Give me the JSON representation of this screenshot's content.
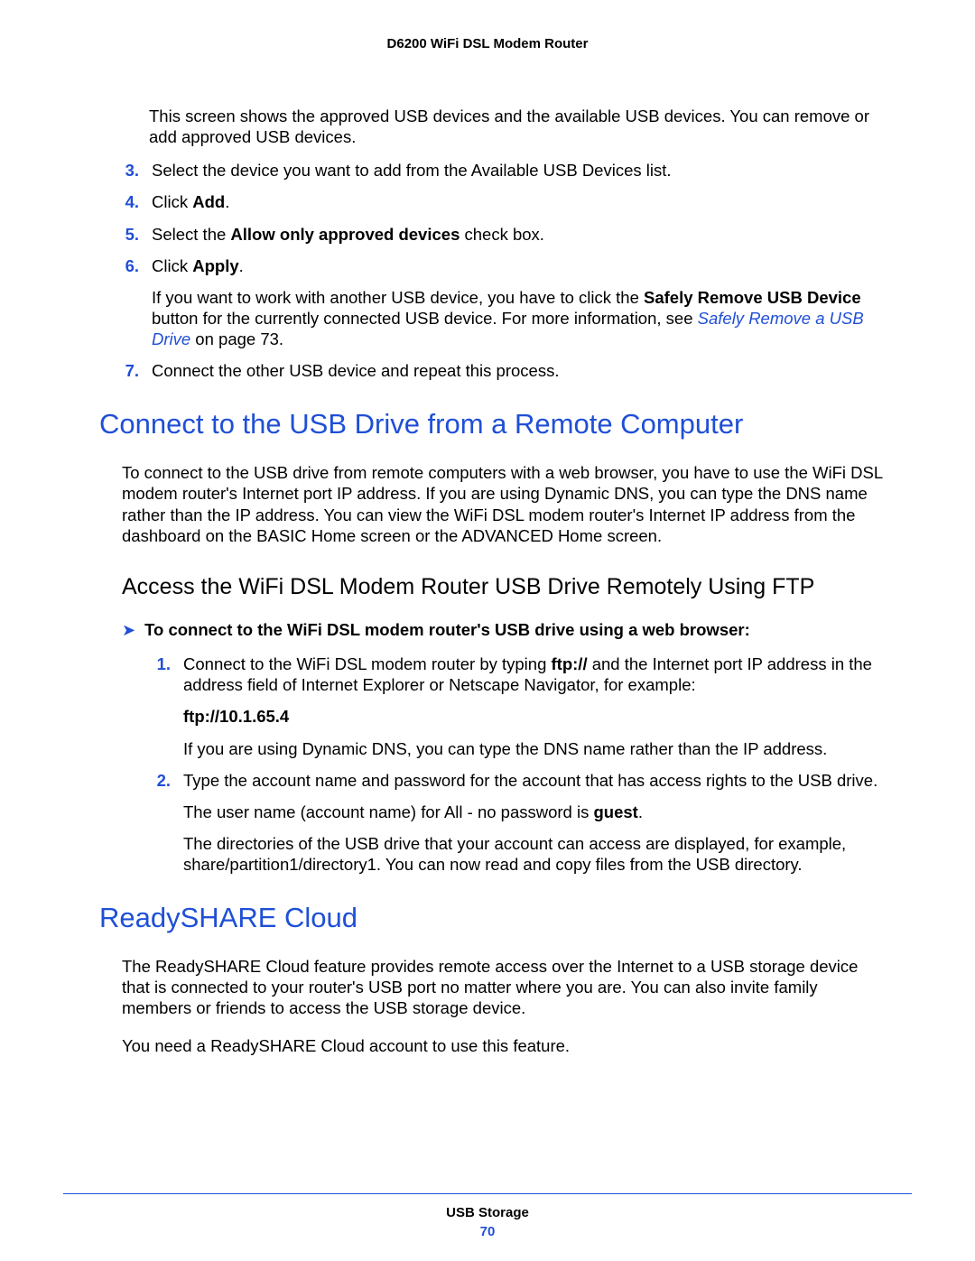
{
  "header": "D6200 WiFi DSL Modem Router",
  "intro": "This screen shows the approved USB devices and the available USB devices. You can remove or add approved USB devices.",
  "steps_a": {
    "s3": {
      "num": "3.",
      "text": "Select the device you want to add from the Available USB Devices list."
    },
    "s4": {
      "num": "4.",
      "pre": "Click ",
      "bold": "Add",
      "post": "."
    },
    "s5": {
      "num": "5.",
      "pre": "Select the ",
      "bold": "Allow only approved devices",
      "post": " check box."
    },
    "s6": {
      "num": "6.",
      "pre": "Click ",
      "bold": "Apply",
      "post": ".",
      "sub_pre": "If you want to work with another USB device, you have to click the ",
      "sub_bold": "Safely Remove USB Device",
      "sub_mid": " button for the currently connected USB device. For more information, see ",
      "sub_link": "Safely Remove a USB Drive",
      "sub_post": " on page 73."
    },
    "s7": {
      "num": "7.",
      "text": "Connect the other USB device and repeat this process."
    }
  },
  "h1_connect": "Connect to the USB Drive from a Remote Computer",
  "para_connect": "To connect to the USB drive from remote computers with a web browser, you have to use the WiFi DSL modem router's Internet port IP address. If you are using Dynamic DNS, you can type the DNS name rather than the IP address. You can view the WiFi DSL modem router's Internet IP address from the dashboard on the BASIC Home screen or the ADVANCED Home screen.",
  "h2_ftp": "Access the WiFi DSL Modem Router USB Drive Remotely Using FTP",
  "arrow_label": "To connect to the WiFi DSL modem router's USB drive using a web browser:",
  "steps_b": {
    "s1": {
      "num": "1.",
      "pre": "Connect to the WiFi DSL modem router by typing ",
      "bold": "ftp://",
      "post": " and the Internet port IP address in the address field of Internet Explorer or Netscape Navigator, for example:",
      "example": "ftp://10.1.65.4",
      "dns_note": "If you are using Dynamic DNS, you can type the DNS name rather than the IP address."
    },
    "s2": {
      "num": "2.",
      "text": "Type the account name and password for the account that has access rights to the USB drive.",
      "un_pre": "The user name (account name) for All - no password is ",
      "un_bold": "guest",
      "un_post": ".",
      "dirs": "The directories of the USB drive that your account can access are displayed, for example, share/partition1/directory1. You can now read and copy files from the USB directory."
    }
  },
  "h1_cloud": "ReadySHARE Cloud",
  "para_cloud1": "The ReadySHARE Cloud feature provides remote access over the Internet to a USB storage device that is connected to your router's USB port no matter where you are. You can also invite family members or friends to access the USB storage device.",
  "para_cloud2": "You need a ReadySHARE Cloud account to use this feature.",
  "footer": {
    "section": "USB Storage",
    "page": "70"
  }
}
